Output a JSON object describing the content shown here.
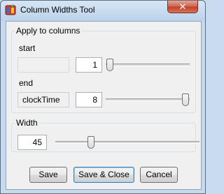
{
  "window": {
    "title": "Column Widths Tool",
    "close_glyph": "✕",
    "app_icon": "application-icon"
  },
  "apply_group": {
    "legend": "Apply to columns",
    "start": {
      "label": "start",
      "name_value": "",
      "number_value": "1",
      "slider_position": 0.0
    },
    "end": {
      "label": "end",
      "name_value": "clockTime",
      "number_value": "8",
      "slider_position": 1.0
    }
  },
  "width_group": {
    "legend": "Width",
    "number_value": "45",
    "slider_position": 0.25
  },
  "buttons": {
    "save": "Save",
    "save_close": "Save & Close",
    "cancel": "Cancel"
  },
  "colors": {
    "titlebar": "#bcd3ea",
    "close_button": "#c9472e",
    "default_button_border": "#3c7fb1"
  }
}
